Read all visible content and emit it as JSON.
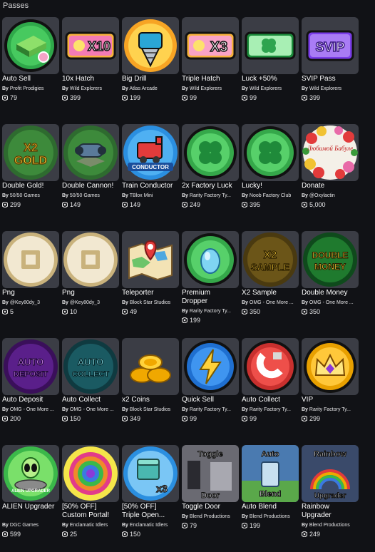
{
  "header": {
    "title": "Passes"
  },
  "robux_icon": "robux-icon",
  "colors": {
    "background": "#111216",
    "card": "#3b3d45",
    "text": "#ffffff"
  },
  "rows": [
    [
      {
        "name": "Auto Sell",
        "creator": "Profit Prodigies",
        "price": "79",
        "icon": "cash-stack-icon"
      },
      {
        "name": "10x Hatch",
        "creator": "Wild Explorers",
        "price": "399",
        "icon": "x10-ticket-icon"
      },
      {
        "name": "Big Drill",
        "creator": "Atlas Arcade",
        "price": "199",
        "icon": "drill-icon"
      },
      {
        "name": "Triple Hatch",
        "creator": "Wild Explorers",
        "price": "99",
        "icon": "x3-ticket-icon"
      },
      {
        "name": "Luck +50%",
        "creator": "Wild Explorers",
        "price": "99",
        "icon": "clover-ticket-icon"
      },
      {
        "name": "SVIP Pass",
        "creator": "Wild Explorers",
        "price": "399",
        "icon": "svip-icon"
      }
    ],
    [
      {
        "name": "Double Gold!",
        "creator": "50/50 Games",
        "price": "299",
        "icon": "x2-gold-icon"
      },
      {
        "name": "Double Cannon!",
        "creator": "50/50 Games",
        "price": "149",
        "icon": "cannon-icon"
      },
      {
        "name": "Train Conductor",
        "creator": "TBlox Mini",
        "price": "149",
        "icon": "train-icon"
      },
      {
        "name": "2x Factory Luck",
        "creator": "Rarity Factory Ty...",
        "price": "249",
        "icon": "clover-circle-icon"
      },
      {
        "name": "Lucky!",
        "creator": "Noob Factory Club",
        "price": "395",
        "icon": "clover-circle-icon"
      },
      {
        "name": "Donate",
        "creator": "@Oxylactin",
        "price": "5,000",
        "icon": "flowers-icon",
        "image_text": "Любимой Бабуле"
      }
    ],
    [
      {
        "name": "Png",
        "creator": "@Key80dy_3",
        "price": "5",
        "icon": "robux-default-icon"
      },
      {
        "name": "Png",
        "creator": "@Key80dy_3",
        "price": "10",
        "icon": "robux-default-icon"
      },
      {
        "name": "Teleporter",
        "creator": "Block Star Studios",
        "price": "49",
        "icon": "map-icon"
      },
      {
        "name": "Premium\nDropper",
        "creator": "Rarity Factory Ty...",
        "price": "199",
        "icon": "egg-icon"
      },
      {
        "name": "X2 Sample",
        "creator": "OMG - One More ...",
        "price": "350",
        "icon": "x2-sample-icon"
      },
      {
        "name": "Double Money",
        "creator": "OMG - One More ...",
        "price": "350",
        "icon": "double-money-icon"
      }
    ],
    [
      {
        "name": "Auto Deposit",
        "creator": "OMG - One More ...",
        "price": "200",
        "icon": "auto-deposit-icon"
      },
      {
        "name": "Auto Collect",
        "creator": "OMG - One More ...",
        "price": "150",
        "icon": "auto-collect-icon"
      },
      {
        "name": "x2 Coins",
        "creator": "Block Star Studios",
        "price": "349",
        "icon": "coins-icon"
      },
      {
        "name": "Quick Sell",
        "creator": "Rarity Factory Ty...",
        "price": "99",
        "icon": "lightning-icon"
      },
      {
        "name": "Auto Collect",
        "creator": "Rarity Factory Ty...",
        "price": "99",
        "icon": "magnet-icon"
      },
      {
        "name": "VIP",
        "creator": "Rarity Factory Ty...",
        "price": "299",
        "icon": "crown-icon"
      }
    ],
    [
      {
        "name": "ALIEN Upgrader",
        "creator": "DGC Games",
        "price": "599",
        "icon": "alien-icon",
        "image_text": "ALIEN UPGRADER"
      },
      {
        "name": "[50% OFF]\nCustom Portal!",
        "creator": "Enclamatic Idlers",
        "price": "25",
        "icon": "portal-icon"
      },
      {
        "name": "[50% OFF]\nTriple Open...",
        "creator": "Enclamatic Idlers",
        "price": "150",
        "icon": "chest-x3-icon"
      },
      {
        "name": "Toggle Door",
        "creator": "Blend Productions",
        "price": "79",
        "icon": "toggle-door-icon"
      },
      {
        "name": "Auto Blend",
        "creator": "Blend Productions",
        "price": "199",
        "icon": "auto-blend-icon"
      },
      {
        "name": "Rainbow\nUpgrader",
        "creator": "Blend Productions",
        "price": "249",
        "icon": "rainbow-upgrader-icon"
      }
    ]
  ],
  "labels": {
    "by": "By",
    "x2": "X2",
    "gold": "GOLD",
    "x10": "X10",
    "x3": "X3",
    "svip": "SVIP",
    "conductor": "CONDUCTOR",
    "sample": "SAMPLE",
    "double": "DOUBLE",
    "money": "MONEY",
    "auto": "AUTO",
    "deposit": "DEPOSIT",
    "collect": "COLLECT",
    "toggle": "Toggle",
    "door": "Door",
    "auto_t": "Auto",
    "blend": "Blend",
    "rainbow": "Rainbow",
    "upgrader": "Upgrader",
    "alien": "ALIEN",
    "upgrader_caps": "UPGRADER",
    "x3_small": "x3"
  }
}
